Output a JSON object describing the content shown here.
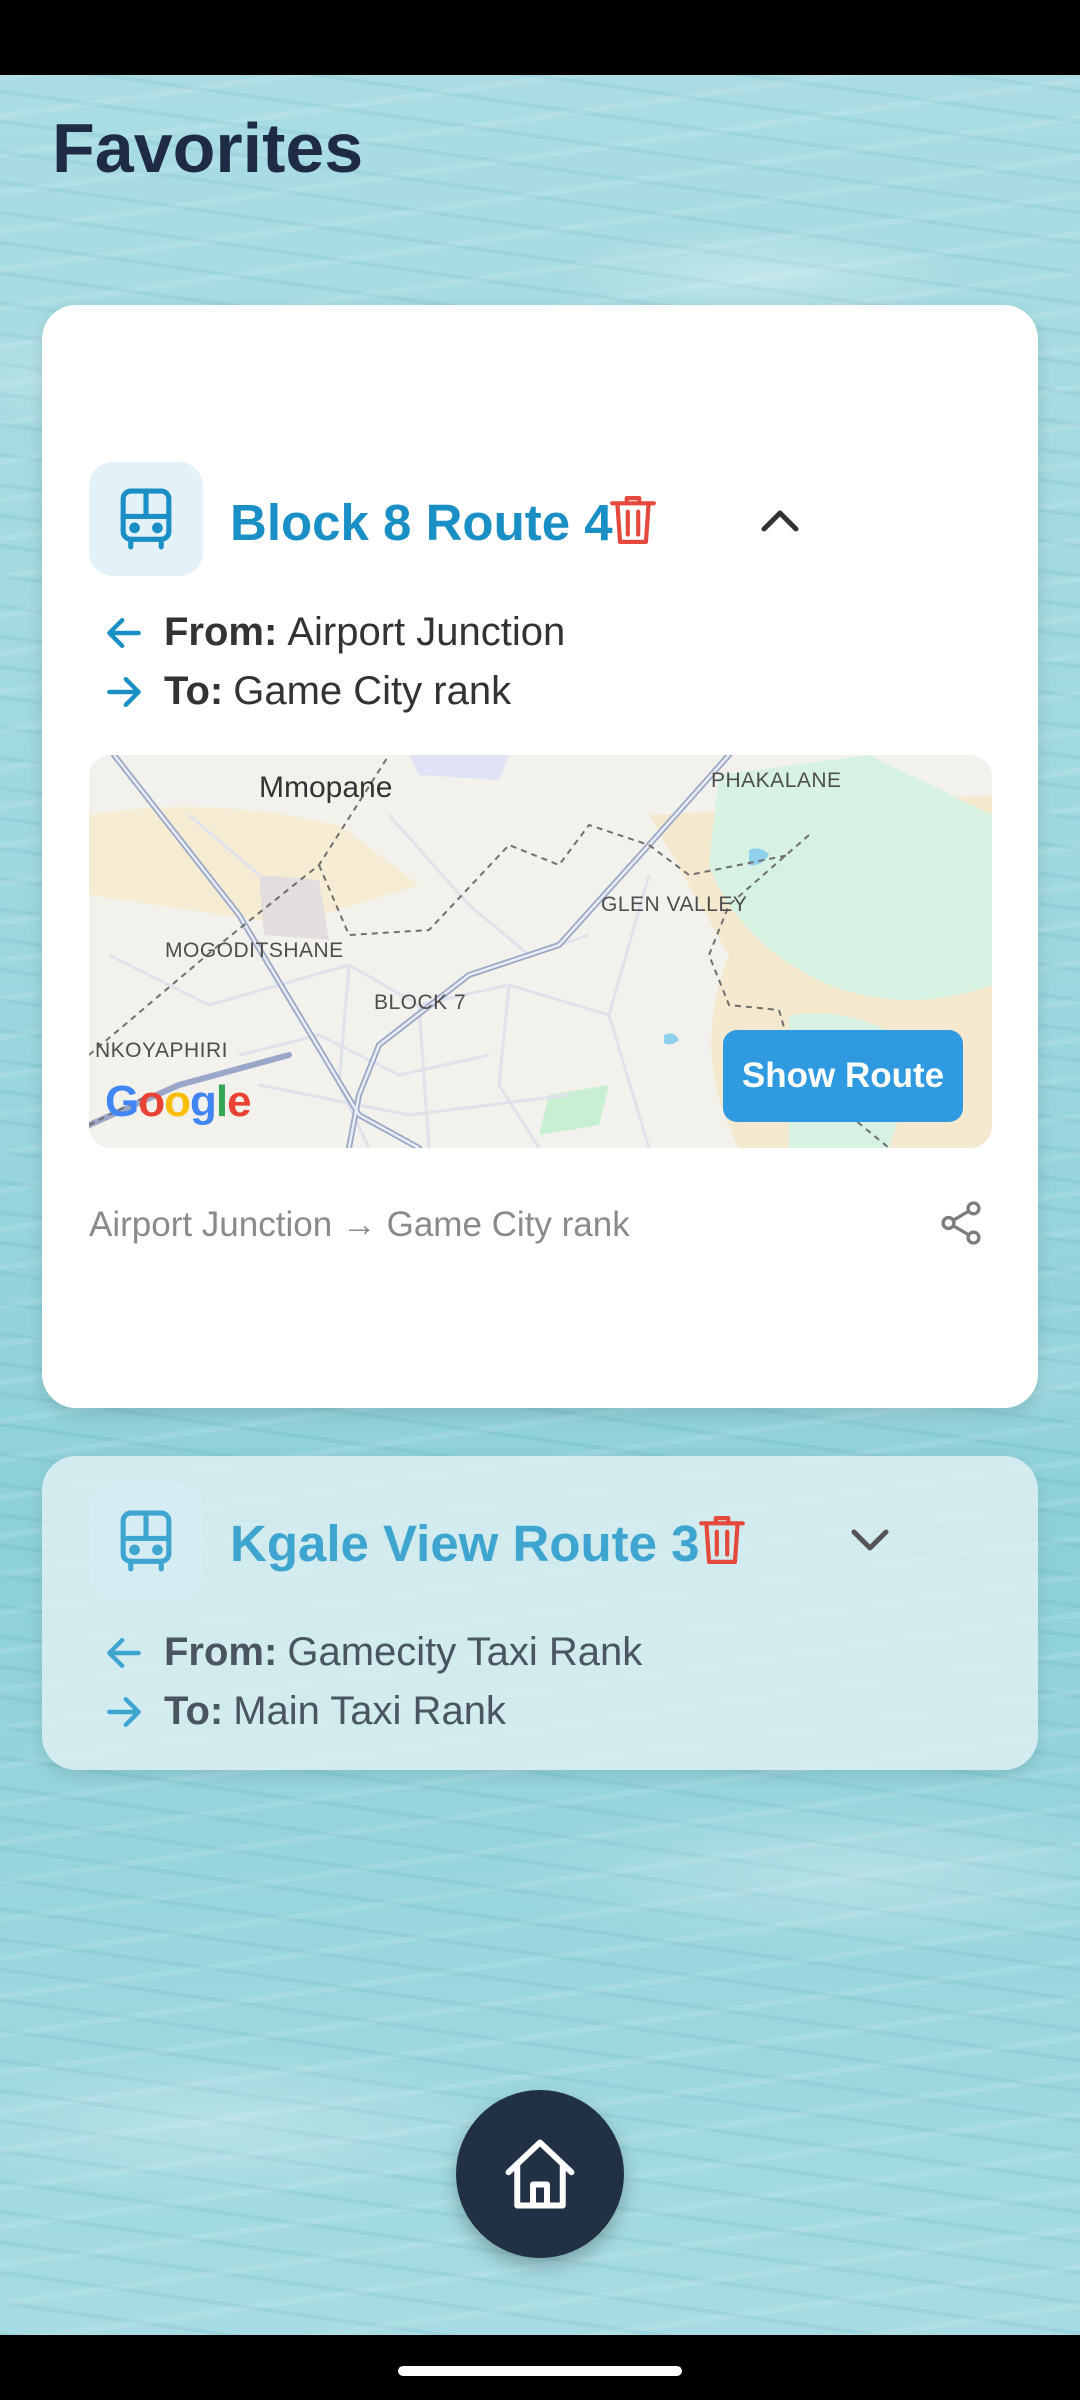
{
  "header": {
    "title": "Favorites"
  },
  "favorites": [
    {
      "title": "Block 8 Route 4",
      "from_label": "From:",
      "from": "Airport Junction",
      "to_label": "To:",
      "to": "Game City rank",
      "expanded": true,
      "map": {
        "places": [
          "Mmopane",
          "PHAKALANE",
          "GLEN VALLEY",
          "MOGODITSHANE",
          "BLOCK 7",
          "NKOYAPHIRI"
        ],
        "attribution": "Google",
        "button_label": "Show Route"
      },
      "summary": "Airport Junction → Game City rank"
    },
    {
      "title": "Kgale View Route 3",
      "from_label": "From:",
      "from": "Gamecity Taxi Rank",
      "to_label": "To:",
      "to": "Main Taxi Rank",
      "expanded": false
    }
  ],
  "icons": {
    "bus": "bus-icon",
    "delete": "trash-icon",
    "collapse": "chevron-up-icon",
    "expand": "chevron-down-icon",
    "from": "arrow-left-icon",
    "to": "arrow-right-icon",
    "share": "share-icon",
    "home": "home-icon"
  },
  "colors": {
    "title": "#1f2a44",
    "accent": "#1a8fc6",
    "delete": "#e5483c",
    "button": "#2f9ae0",
    "fab": "#213042"
  }
}
